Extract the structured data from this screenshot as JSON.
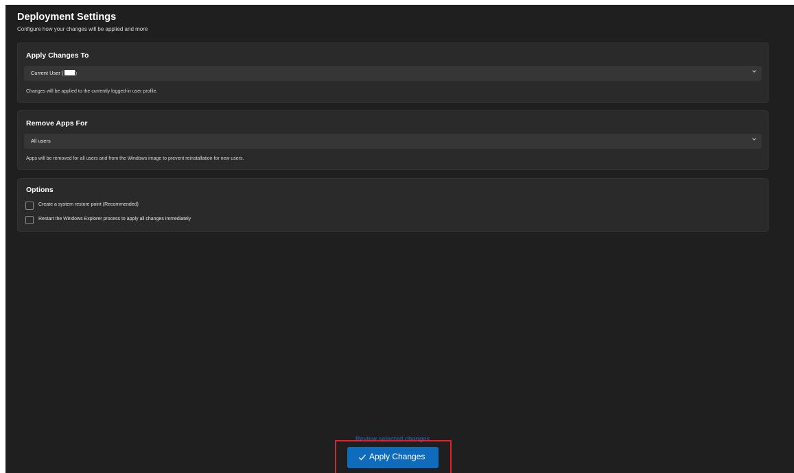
{
  "header": {
    "title": "Deployment Settings",
    "subtitle": "Configure how your changes will be applied and more"
  },
  "apply_changes_to": {
    "title": "Apply Changes To",
    "select_value_prefix": "Current User (",
    "select_value_suffix": ")",
    "description": "Changes will be applied to the currently logged-in user profile."
  },
  "remove_apps_for": {
    "title": "Remove Apps For",
    "select_value": "All users",
    "description": "Apps will be removed for all users and from the Windows image to prevent reinstallation for new users."
  },
  "options": {
    "title": "Options",
    "items": [
      {
        "label": "Create a system restore point (Recommended)",
        "checked": false
      },
      {
        "label": "Restart the Windows Explorer process to apply all changes immediately",
        "checked": false
      }
    ]
  },
  "footer": {
    "review_link": "Review selected changes",
    "apply_label": "Apply Changes",
    "apply_icon": "check-icon",
    "accent_color": "#0f6cbd",
    "highlight_color": "#e0202a"
  }
}
